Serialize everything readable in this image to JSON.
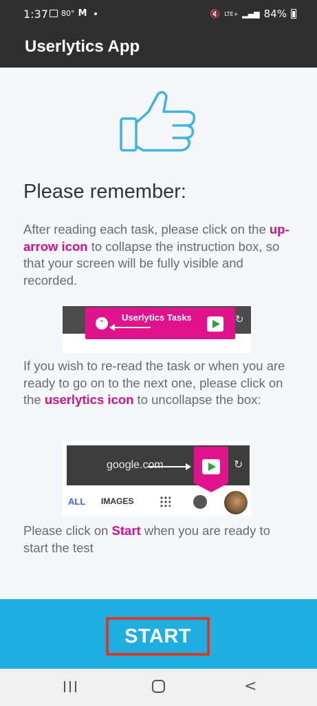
{
  "status_bar": {
    "time": "1:37",
    "temperature": "80°",
    "battery": "84%",
    "network": "LTE+"
  },
  "app_bar": {
    "title": "Userlytics App"
  },
  "icons": {
    "thumb": "thumbs-up-icon"
  },
  "main": {
    "heading": "Please remember:",
    "p1": {
      "before": "After reading each task, please click on the ",
      "highlight": "up-arrow icon",
      "after": " to collapse the instruction box, so that your screen will be fully visible and recorded."
    },
    "screenshot1": {
      "title": "Userlytics Tasks"
    },
    "p2": {
      "before": "If you wish to re-read the task or when you are ready to go on to the next one, please click on the ",
      "highlight": "userlytics icon",
      "after": " to uncollapse the box:"
    },
    "screenshot2": {
      "url": "google.com",
      "tab_all": "ALL",
      "tab_images": "IMAGES"
    },
    "p3": {
      "before": "Please click on ",
      "highlight": "Start",
      "after": " when you are ready to start the test"
    }
  },
  "footer": {
    "start_label": "START"
  },
  "colors": {
    "highlight": "#d1128d",
    "footer_bg": "#1eaee1",
    "app_bar_bg": "#2f2f2f",
    "button_border": "#d93a25"
  }
}
